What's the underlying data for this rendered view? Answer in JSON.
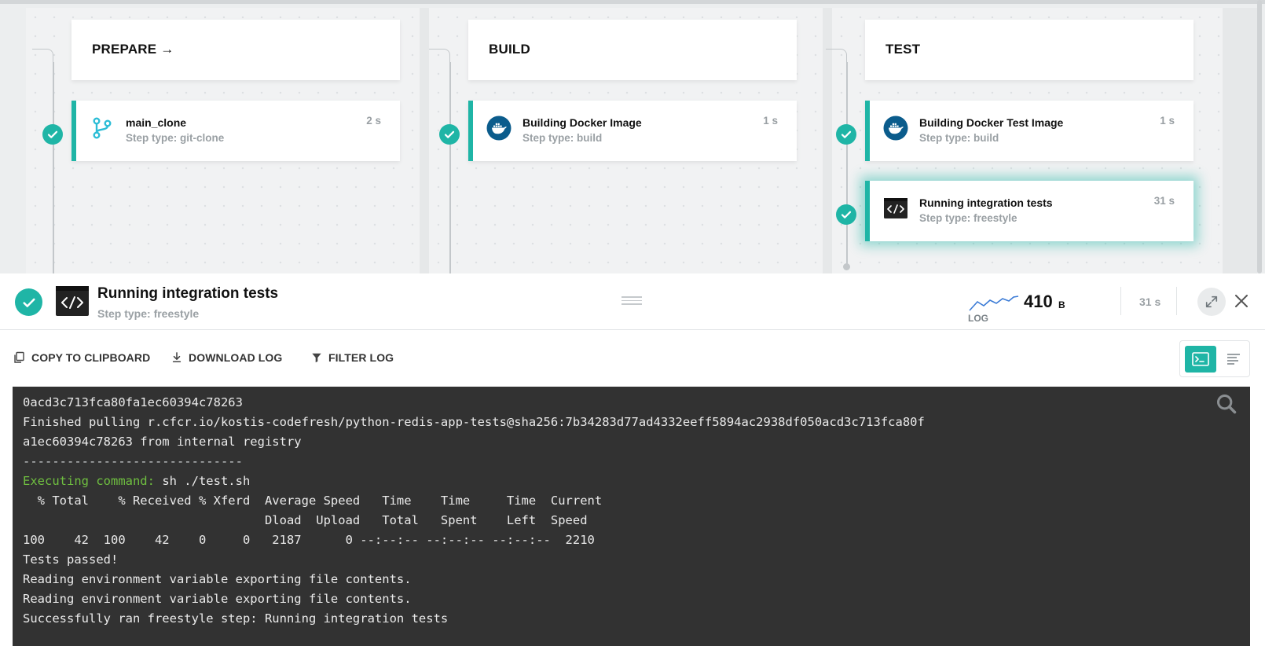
{
  "stages": [
    {
      "name": "PREPARE →"
    },
    {
      "name": "BUILD"
    },
    {
      "name": "TEST"
    }
  ],
  "steps": [
    {
      "title": "main_clone",
      "type": "Step type: git-clone",
      "time": "2 s",
      "icon": "git-branch-icon"
    },
    {
      "title": "Building Docker Image",
      "type": "Step type: build",
      "time": "1 s",
      "icon": "docker-icon"
    },
    {
      "title": "Building Docker Test Image",
      "type": "Step type: build",
      "time": "1 s",
      "icon": "docker-icon"
    },
    {
      "title": "Running integration tests",
      "type": "Step type: freestyle",
      "time": "31 s",
      "icon": "terminal-icon"
    }
  ],
  "detail": {
    "title": "Running integration tests",
    "subtitle": "Step type: freestyle",
    "log_label": "LOG",
    "log_size": "410",
    "log_unit": "B",
    "duration": "31 s"
  },
  "toolbar": {
    "copy_label": "COPY TO CLIPBOARD",
    "download_label": "DOWNLOAD LOG",
    "filter_label": "FILTER LOG"
  },
  "log": {
    "lines": [
      "0acd3c713fca80fa1ec60394c78263",
      "Finished pulling r.cfcr.io/kostis-codefresh/python-redis-app-tests@sha256:7b34283d77ad4332eeff5894ac2938df050acd3c713fca80f",
      "a1ec60394c78263 from internal registry",
      "------------------------------",
      "",
      "  % Total    % Received % Xferd  Average Speed   Time    Time     Time  Current",
      "                                 Dload  Upload   Total   Spent    Left  Speed",
      "100    42  100    42    0     0   2187      0 --:--:-- --:--:-- --:--:--  2210",
      "Tests passed!",
      "Reading environment variable exporting file contents.",
      "Reading environment variable exporting file contents.",
      "Successfully ran freestyle step: Running integration tests"
    ],
    "exec_prefix": "Executing command: ",
    "exec_command": "sh ./test.sh"
  },
  "colors": {
    "accent": "#1fb5a6",
    "log_bg": "#323232",
    "exec_green": "#6fbf40"
  }
}
